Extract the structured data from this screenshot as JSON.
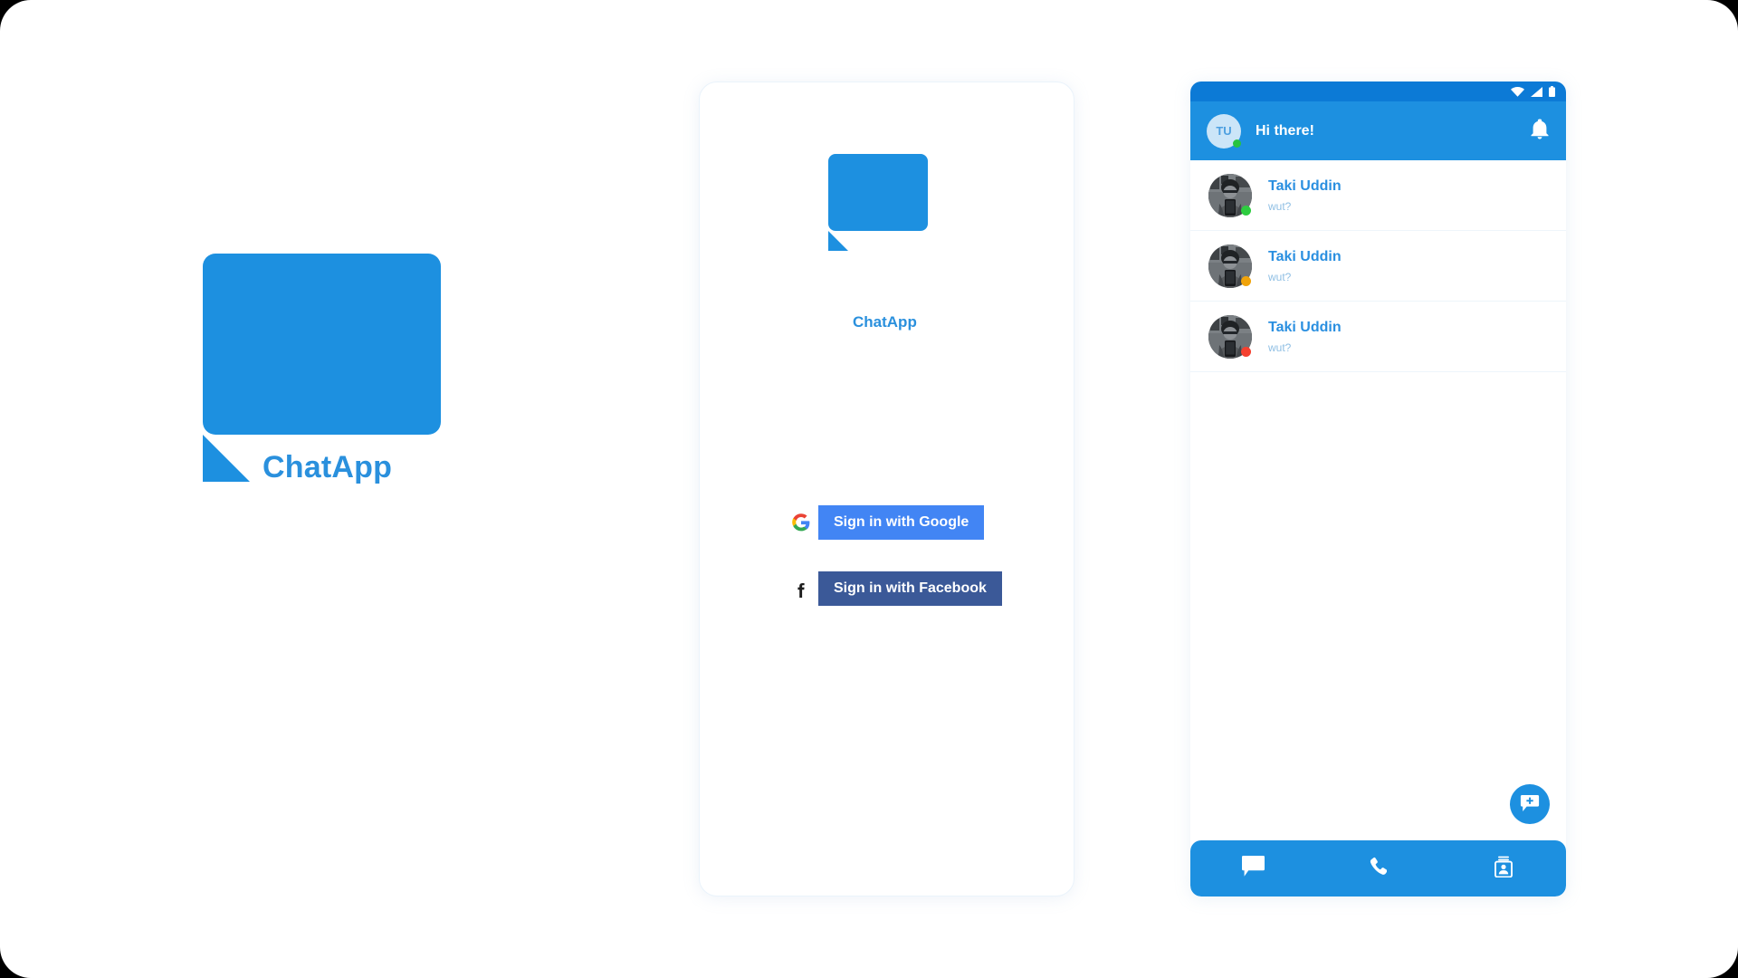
{
  "brand": {
    "name": "ChatApp",
    "accent": "#1d90e0",
    "accent_dark": "#0c7ad6",
    "text_blue": "#2a90dd"
  },
  "logo_panel": {
    "bubble_icon": "speech-bubble-icon",
    "wordmark": "ChatApp"
  },
  "signin_card": {
    "logo_icon": "speech-bubble-icon",
    "wordmark": "ChatApp",
    "buttons": [
      {
        "label": "Sign in with Google",
        "icon": "google-g-icon",
        "color": "#4285f4"
      },
      {
        "label": "Sign in with Facebook",
        "icon": "facebook-f-icon",
        "color": "#3b5998"
      }
    ]
  },
  "phone": {
    "status_bar": {
      "icons": [
        "wifi-icon",
        "cell-signal-icon",
        "battery-icon"
      ]
    },
    "header": {
      "avatar_initials": "TU",
      "avatar_status_color": "#28c340",
      "title": "Hi there!",
      "action_icon": "bell-icon"
    },
    "chats": [
      {
        "name": "Taki Uddin",
        "message": "wut?",
        "status_color": "#2ecc40",
        "avatar": "user-photo-avatar"
      },
      {
        "name": "Taki Uddin",
        "message": "wut?",
        "status_color": "#f0a30a",
        "avatar": "user-photo-avatar"
      },
      {
        "name": "Taki Uddin",
        "message": "wut?",
        "status_color": "#f4402f",
        "avatar": "user-photo-avatar"
      }
    ],
    "fab": {
      "icon": "new-chat-plus-icon",
      "color": "#1d90e0"
    },
    "bottom_nav": [
      {
        "icon": "chat-bubble-icon",
        "active": true
      },
      {
        "icon": "phone-handset-icon",
        "active": false
      },
      {
        "icon": "contacts-card-icon",
        "active": false
      }
    ]
  }
}
